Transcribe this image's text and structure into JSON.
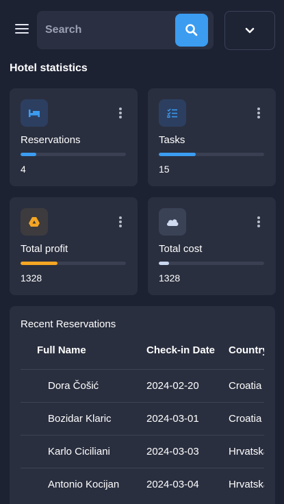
{
  "search": {
    "placeholder": "Search"
  },
  "icons": {
    "menu": "hamburger-icon",
    "search": "search-icon",
    "dropdown": "chevron-down-icon"
  },
  "section_title": "Hotel statistics",
  "stats": [
    {
      "label": "Reservations",
      "value": "4",
      "icon": "bed-icon",
      "progress": 0.15,
      "color": "#3b9cf0"
    },
    {
      "label": "Tasks",
      "value": "15",
      "icon": "checklist-icon",
      "progress": 0.35,
      "color": "#3b9cf0"
    },
    {
      "label": "Total profit",
      "value": "1328",
      "icon": "drive-icon",
      "progress": 0.35,
      "color": "#f5a623"
    },
    {
      "label": "Total cost",
      "value": "1328",
      "icon": "cloud-icon",
      "progress": 0.1,
      "color": "#c9d6f0"
    }
  ],
  "reservations": {
    "title": "Recent Reservations",
    "columns": [
      "Full Name",
      "Check-in Date",
      "Country"
    ],
    "rows": [
      [
        "Dora Čošić",
        "2024-02-20",
        "Croatia"
      ],
      [
        "Bozidar Klaric",
        "2024-03-01",
        "Croatia"
      ],
      [
        "Karlo Ciciliani",
        "2024-03-03",
        "Hrvatska"
      ],
      [
        "Antonio Kocijan",
        "2024-03-04",
        "Hrvatska"
      ]
    ]
  }
}
